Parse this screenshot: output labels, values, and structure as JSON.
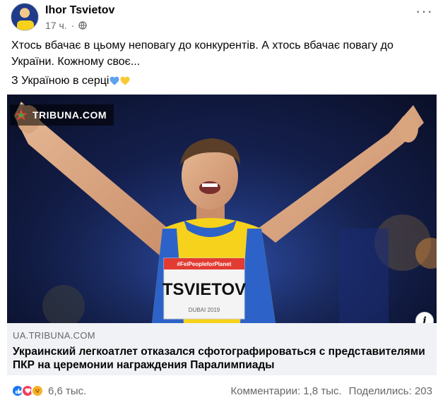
{
  "post": {
    "author": "Ihor Tsvietov",
    "time": "17 ч.",
    "separator": "·",
    "privacy_icon": "globe-icon",
    "more_icon": "more-options-icon",
    "more_label": "···",
    "text_line_1": "Хтось вбачає в цьому неповагу до конкурентів. А хтось вбачає повагу до України. Кожному своє...",
    "text_line_2": "З Україною в серці",
    "emojis": [
      "blue-heart-icon",
      "yellow-heart-icon"
    ]
  },
  "image": {
    "watermark": "TRIBUNA.COM",
    "bib_name": "TSVIETOV",
    "bib_top": "#FeiPeopleforPlanet",
    "bib_event": "DUBAI 2019",
    "info_label": "i"
  },
  "link_preview": {
    "domain": "UA.TRIBUNA.COM",
    "headline": "Украинский легкоатлет отказался сфотографироваться с представителями ПКР на церемонии награждения Паралимпиады"
  },
  "reactions": {
    "icons": [
      "like-icon",
      "love-icon",
      "haha-icon"
    ],
    "count": "6,6 тыс.",
    "comments": "Комментарии: 1,8 тыс.",
    "shares": "Поделились: 203"
  },
  "colors": {
    "text_secondary": "#65676b",
    "like_blue": "#1877f2",
    "preview_bg": "#f0f2f5",
    "ukraine_blue": "#2d63c8",
    "ukraine_yellow": "#f6d21c"
  }
}
